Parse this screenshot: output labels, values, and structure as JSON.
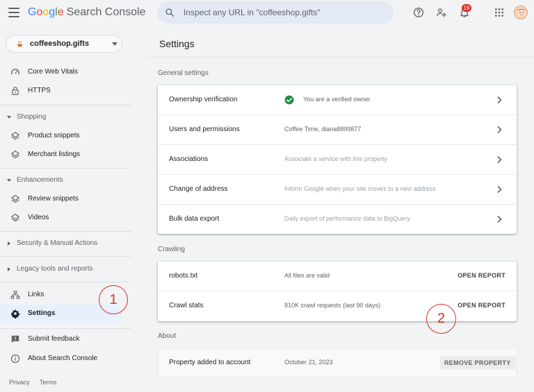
{
  "header": {
    "logo_parts": [
      "G",
      "o",
      "o",
      "g",
      "l",
      "e"
    ],
    "product": "Search Console",
    "search_placeholder": "Inspect any URL in \"coffeeshop.gifts\"",
    "notification_count": "19"
  },
  "property": {
    "name": "coffeeshop.gifts"
  },
  "sidebar": {
    "items": [
      {
        "label": "Core Web Vitals",
        "icon": "speedometer-icon"
      },
      {
        "label": "HTTPS",
        "icon": "lock-icon"
      },
      {
        "section": "Shopping"
      },
      {
        "label": "Product snippets",
        "icon": "layers-icon"
      },
      {
        "label": "Merchant listings",
        "icon": "layers-icon"
      },
      {
        "section": "Enhancements"
      },
      {
        "label": "Review snippets",
        "icon": "layers-icon"
      },
      {
        "label": "Videos",
        "icon": "layers-icon"
      },
      {
        "section": "Security & Manual Actions"
      },
      {
        "section": "Legacy tools and reports"
      },
      {
        "label": "Links",
        "icon": "sitemap-icon"
      },
      {
        "label": "Settings",
        "icon": "gear-icon",
        "active": true
      },
      {
        "label": "Submit feedback",
        "icon": "feedback-icon"
      },
      {
        "label": "About Search Console",
        "icon": "info-icon"
      }
    ],
    "footer": {
      "privacy": "Privacy",
      "terms": "Terms"
    }
  },
  "main": {
    "title": "Settings",
    "general": {
      "heading": "General settings",
      "rows": [
        {
          "label": "Ownership verification",
          "value": "You are a verified owner"
        },
        {
          "label": "Users and permissions",
          "value": "Coffee Time, diana8899877"
        },
        {
          "label": "Associations",
          "value": "Associate a service with this property"
        },
        {
          "label": "Change of address",
          "value": "Inform Google when your site moves to a new address"
        },
        {
          "label": "Bulk data export",
          "value": "Daily export of performance data to BigQuery"
        }
      ]
    },
    "crawling": {
      "heading": "Crawling",
      "rows": [
        {
          "label": "robots.txt",
          "value": "All files are valid",
          "action": "OPEN REPORT"
        },
        {
          "label": "Crawl stats",
          "value": "810K crawl requests (last 90 days)",
          "action": "OPEN REPORT"
        }
      ]
    },
    "about": {
      "heading": "About",
      "row": {
        "label": "Property added to account",
        "value": "October 21, 2023",
        "action": "REMOVE PROPERTY"
      }
    }
  },
  "annotations": {
    "one": "1",
    "two": "2"
  },
  "colors": {
    "accent": "#1a73e8",
    "active_bg": "#e8f0fe",
    "verified": "#1e8e3e",
    "annotation": "#d93025"
  }
}
